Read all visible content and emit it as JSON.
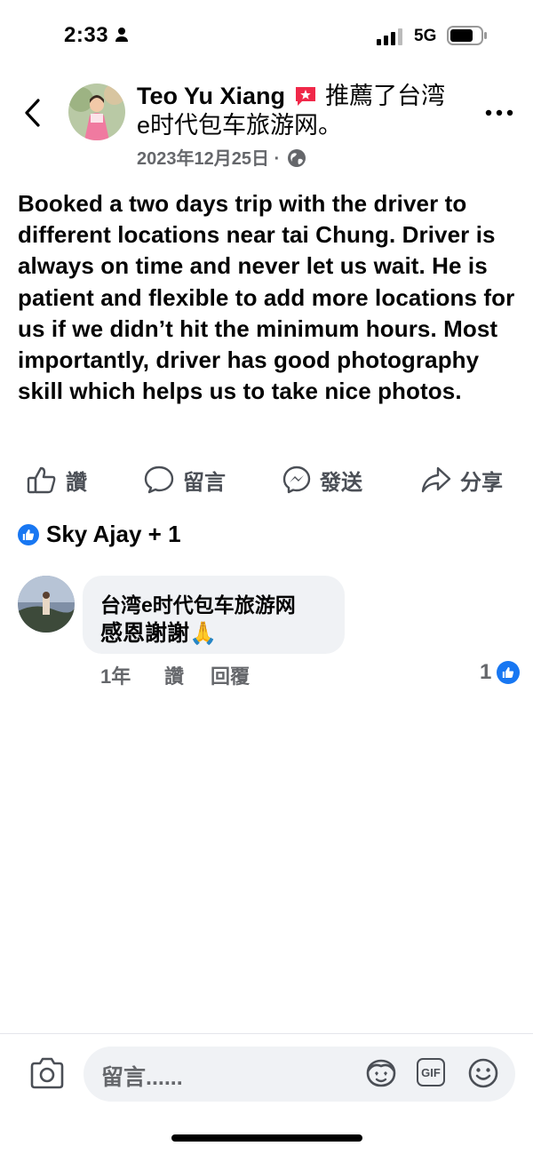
{
  "status_bar": {
    "time": "2:33",
    "network": "5G"
  },
  "post": {
    "author": "Teo Yu Xiang",
    "recommend_text": "推薦了台湾e时代包车旅游网。",
    "date": "2023年12月25日 ·",
    "body": "Booked a two days trip with the driver to different locations near tai Chung. Driver is always on time and never let us wait. He is patient and flexible to add more locations for us if we didn’t hit the minimum hours. Most importantly, driver has good photography skill which helps us to take nice photos."
  },
  "actions": {
    "like": "讚",
    "comment": "留言",
    "send": "發送",
    "share": "分享"
  },
  "reactions": {
    "text": "Sky Ajay + 1"
  },
  "comment": {
    "author": "台湾e时代包车旅游网",
    "text": "感恩謝謝🙏",
    "time": "1年",
    "like": "讚",
    "reply": "回覆",
    "like_count": "1"
  },
  "composer": {
    "placeholder": "留言......",
    "gif_label": "GIF"
  },
  "colors": {
    "brand_blue": "#1877f2",
    "recommend_red": "#f02849",
    "muted": "#65676b"
  }
}
